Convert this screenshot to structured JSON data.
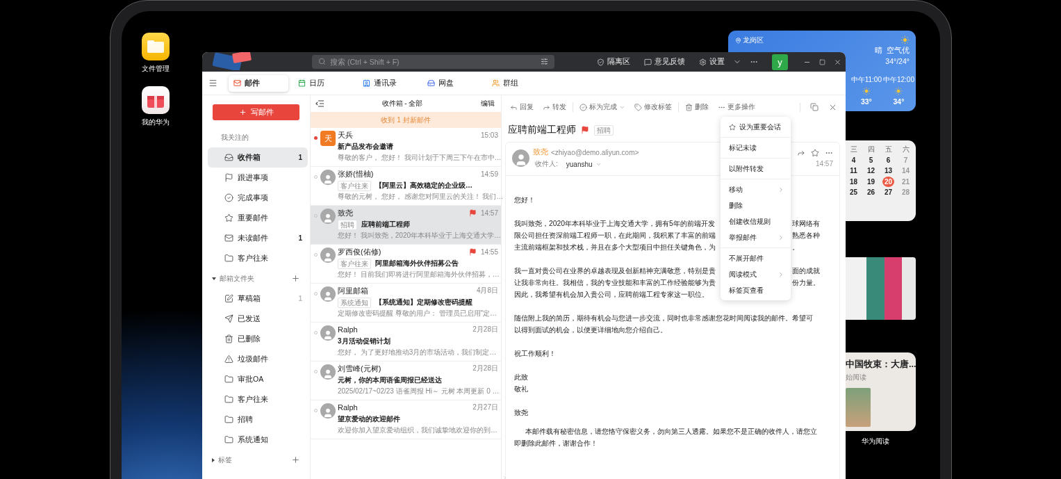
{
  "desktop": {
    "icons": [
      {
        "label": "文件管理",
        "kind": "files"
      },
      {
        "label": "我的华为",
        "kind": "gift"
      }
    ]
  },
  "widgets": {
    "weather": {
      "location": "龙岗区",
      "condition": "晴",
      "air": "空气优",
      "range": "34°/24°",
      "hours": [
        {
          "time": "中午11:00",
          "temp": "33°"
        },
        {
          "time": "中午12:00",
          "temp": "34°"
        }
      ]
    },
    "calendar": {
      "weekdays": [
        "三",
        "四",
        "五",
        "六"
      ],
      "weeks": [
        [
          {
            "day": "4",
            "selected": false
          },
          {
            "day": "5",
            "selected": false
          },
          {
            "day": "6",
            "selected": false
          },
          {
            "day": "7",
            "selected": false
          }
        ],
        [
          {
            "day": "11",
            "selected": false
          },
          {
            "day": "12",
            "selected": false
          },
          {
            "day": "13",
            "selected": false
          },
          {
            "day": "14",
            "selected": false
          }
        ],
        [
          {
            "day": "18",
            "selected": false
          },
          {
            "day": "19",
            "selected": false
          },
          {
            "day": "20",
            "selected": true
          },
          {
            "day": "21",
            "selected": false
          }
        ],
        [
          {
            "day": "25",
            "selected": false
          },
          {
            "day": "26",
            "selected": false
          },
          {
            "day": "27",
            "selected": false
          },
          {
            "day": "28",
            "selected": false
          }
        ]
      ]
    },
    "reading": {
      "title": "中国牧束：大唐...",
      "subtitle": "始阅读",
      "app_label": "华为阅读"
    }
  },
  "window": {
    "title_bar": {
      "search_placeholder": "搜索 (Ctrl + Shift + F)",
      "actions": [
        {
          "label": "隔离区",
          "kind": "quarantine"
        },
        {
          "label": "意见反馈",
          "kind": "feedback"
        },
        {
          "label": "设置",
          "kind": "settings"
        }
      ],
      "avatar": "y"
    },
    "tabs": [
      {
        "label": "邮件",
        "kind": "mail",
        "selected": true
      },
      {
        "label": "日历",
        "kind": "calendar",
        "selected": false
      },
      {
        "label": "通讯录",
        "kind": "contacts",
        "selected": false
      },
      {
        "label": "网盘",
        "kind": "drive",
        "selected": false
      },
      {
        "label": "群组",
        "kind": "group",
        "selected": false
      }
    ],
    "sidebar": {
      "compose_button": "写邮件",
      "sections": [
        {
          "title": "我关注的",
          "kind": "fixed",
          "items": [
            {
              "label": "收件箱",
              "kind": "inbox",
              "count": "1",
              "selected": true
            },
            {
              "label": "跟进事项",
              "kind": "flag",
              "selected": false
            },
            {
              "label": "完成事项",
              "kind": "done",
              "selected": false
            },
            {
              "label": "重要邮件",
              "kind": "star",
              "selected": false
            },
            {
              "label": "未读邮件",
              "kind": "unread",
              "count": "1",
              "selected": false
            },
            {
              "label": "客户往来",
              "kind": "folder",
              "selected": false
            }
          ]
        },
        {
          "title": "邮箱文件夹",
          "kind": "toggle",
          "expanded": true,
          "items": [
            {
              "label": "草稿箱",
              "kind": "draft",
              "count": "1",
              "selected": false
            },
            {
              "label": "已发送",
              "kind": "sent",
              "selected": false
            },
            {
              "label": "已删除",
              "kind": "trash",
              "selected": false
            },
            {
              "label": "垃圾邮件",
              "kind": "spam",
              "selected": false
            },
            {
              "label": "审批OA",
              "kind": "folder",
              "selected": false
            },
            {
              "label": "客户往来",
              "kind": "folder",
              "selected": false
            },
            {
              "label": "招聘",
              "kind": "folder",
              "selected": false
            },
            {
              "label": "系统通知",
              "kind": "folder",
              "selected": false
            }
          ]
        },
        {
          "title": "标签",
          "kind": "toggle",
          "expanded": false
        }
      ]
    },
    "mail_list": {
      "title": "收件箱 - 全部",
      "edit": "编辑",
      "banner": "收到 1 封新邮件",
      "emails": [
        {
          "sender": "天兵",
          "avatar": {
            "kind": "letter",
            "text": "天"
          },
          "time": "15:03",
          "subject": "新产品发布会邀请",
          "preview": "尊敬的客户， 您好！ 我司计划于下周三下午在市中…",
          "unread": true,
          "flagged": false,
          "selected": false
        },
        {
          "sender": "张娇(惜柚)",
          "avatar": {
            "kind": "person"
          },
          "time": "14:59",
          "tag": "客户往来",
          "subject": "【阿里云】高效稳定的企业级…",
          "preview": "尊敬的元树， 您好， 感谢您对阿里云的关注！ 我们…",
          "unread": false,
          "flagged": false,
          "selected": false
        },
        {
          "sender": "致尧",
          "avatar": {
            "kind": "person"
          },
          "time": "14:57",
          "tag": "招聘",
          "subject": "应聘前端工程师",
          "preview": "您好！ 我叫致尧，2020年本科毕业于上海交通大学…",
          "unread": false,
          "flagged": true,
          "selected": true
        },
        {
          "sender": "罗西俊(佑修)",
          "avatar": {
            "kind": "person"
          },
          "time": "14:55",
          "tag": "客户往来",
          "subject": "阿里邮箱海外伙伴招募公告",
          "preview": "您好！ 目前我们即将进行阿里邮箱海外伙伴招募，…",
          "unread": false,
          "flagged": true,
          "selected": false
        },
        {
          "sender": "阿里邮箱",
          "avatar": {
            "kind": "person"
          },
          "time": "4月8日",
          "tag": "系统通知",
          "subject": "【系统通知】定期修改密码提醒",
          "preview": "定期修改密码提醒 尊敬的用户： 管理员已启用\"定…",
          "unread": false,
          "flagged": false,
          "selected": false
        },
        {
          "sender": "Ralph",
          "avatar": {
            "kind": "person"
          },
          "time": "2月28日",
          "subject": "3月活动促销计划",
          "preview": "您好， 为了更好地推动3月的市场活动，我们制定…",
          "unread": false,
          "flagged": false,
          "selected": false
        },
        {
          "sender": "刘雪峰(元树)",
          "avatar": {
            "kind": "person"
          },
          "time": "2月28日",
          "subject": "元树，你的本周语雀周报已经送达",
          "preview": "2025/02/17~02/23 语雀周报 Hi～ 元树 本周更新 0 …",
          "unread": false,
          "flagged": false,
          "selected": false
        },
        {
          "sender": "Ralph",
          "avatar": {
            "kind": "person"
          },
          "time": "2月27日",
          "subject": "望京爱动的欢迎邮件",
          "preview": "欢迎你加入望京爱动组织，我们诚挚地欢迎你的到…",
          "unread": false,
          "flagged": false,
          "selected": false
        }
      ]
    },
    "reader": {
      "toolbar": [
        [
          {
            "label": "回复",
            "kind": "reply",
            "dropdown": false
          },
          {
            "label": "转发",
            "kind": "forward",
            "dropdown": false
          }
        ],
        [
          {
            "label": "标为完成",
            "kind": "done",
            "dropdown": true
          },
          {
            "label": "修改标签",
            "kind": "tag",
            "dropdown": false
          }
        ],
        [
          {
            "label": "删除",
            "kind": "delete",
            "dropdown": false
          },
          {
            "label": "更多操作",
            "kind": "more",
            "dropdown": false
          }
        ]
      ],
      "subject": "应聘前端工程师",
      "flagged": true,
      "tag": "招聘",
      "message": {
        "sender_name": "致尧",
        "sender_email": "<zhiyao@demo.aliyun.com>",
        "recipient_label": "收件人:",
        "recipient": "yuanshu",
        "time": "14:57",
        "body": [
          {
            "kind": "text",
            "lines": [
              {
                "text": "您好！"
              }
            ]
          },
          {
            "kind": "text",
            "lines": [
              {
                "text": "我叫致尧，2020年本科毕业于上海交通大学，拥有5年的前端开发",
                "right": "球网络有"
              },
              {
                "text": "限公司担任资深前端工程师一职，在此期间，我积累了丰富的前端",
                "right": "熟悉各种"
              },
              {
                "text": "主流前端框架和技术栈，并且在多个大型项目中担任关键角色，为",
                "right": "。"
              }
            ]
          },
          {
            "kind": "text",
            "lines": [
              {
                "text": "我一直对贵公司在业界的卓越表现及创新精神充满敬意，特别是贵",
                "right": "面的成就"
              },
              {
                "text": "让我非常向往。我相信，我的专业技能和丰富的工作经验能够为贵",
                "right": "份力量。"
              },
              {
                "text": "因此，我希望有机会加入贵公司，应聘前端工程专家这一职位。"
              }
            ]
          },
          {
            "kind": "text",
            "lines": [
              {
                "text": "随信附上我的简历，期待有机会与您进一步交流，同时也非常感谢您花时间阅读我的邮件。希望可"
              },
              {
                "text": "以得到面试的机会，以便更详细地向您介绍自己。"
              }
            ]
          },
          {
            "kind": "text",
            "lines": [
              {
                "text": "祝工作顺利！"
              }
            ]
          },
          {
            "kind": "text",
            "lines": [
              {
                "text": "此致"
              },
              {
                "text": "敬礼"
              }
            ]
          },
          {
            "kind": "text",
            "lines": [
              {
                "text": "致尧"
              }
            ]
          },
          {
            "kind": "notice",
            "lines": [
              {
                "text": "本邮件载有秘密信息，请您恪守保密义务，勿向第三人透露。如果您不是正确的收件人，请您立"
              },
              {
                "text": "即删除此邮件，谢谢合作！"
              }
            ]
          }
        ]
      }
    },
    "context_menu": [
      [
        {
          "label": "设为重要会话",
          "kind": "star",
          "submenu": false
        }
      ],
      [
        {
          "label": "标记未读",
          "kind": "plain",
          "submenu": false
        }
      ],
      [
        {
          "label": "以附件转发",
          "kind": "plain",
          "submenu": false
        }
      ],
      [
        {
          "label": "移动",
          "kind": "plain",
          "submenu": true
        },
        {
          "label": "删除",
          "kind": "plain",
          "submenu": false
        },
        {
          "label": "创建收信规则",
          "kind": "plain",
          "submenu": false
        },
        {
          "label": "举报邮件",
          "kind": "plain",
          "submenu": true
        }
      ],
      [
        {
          "label": "不展开邮件",
          "kind": "plain",
          "submenu": false
        },
        {
          "label": "阅读模式",
          "kind": "plain",
          "submenu": true
        },
        {
          "label": "标签页查看",
          "kind": "plain",
          "submenu": false
        }
      ]
    ]
  }
}
